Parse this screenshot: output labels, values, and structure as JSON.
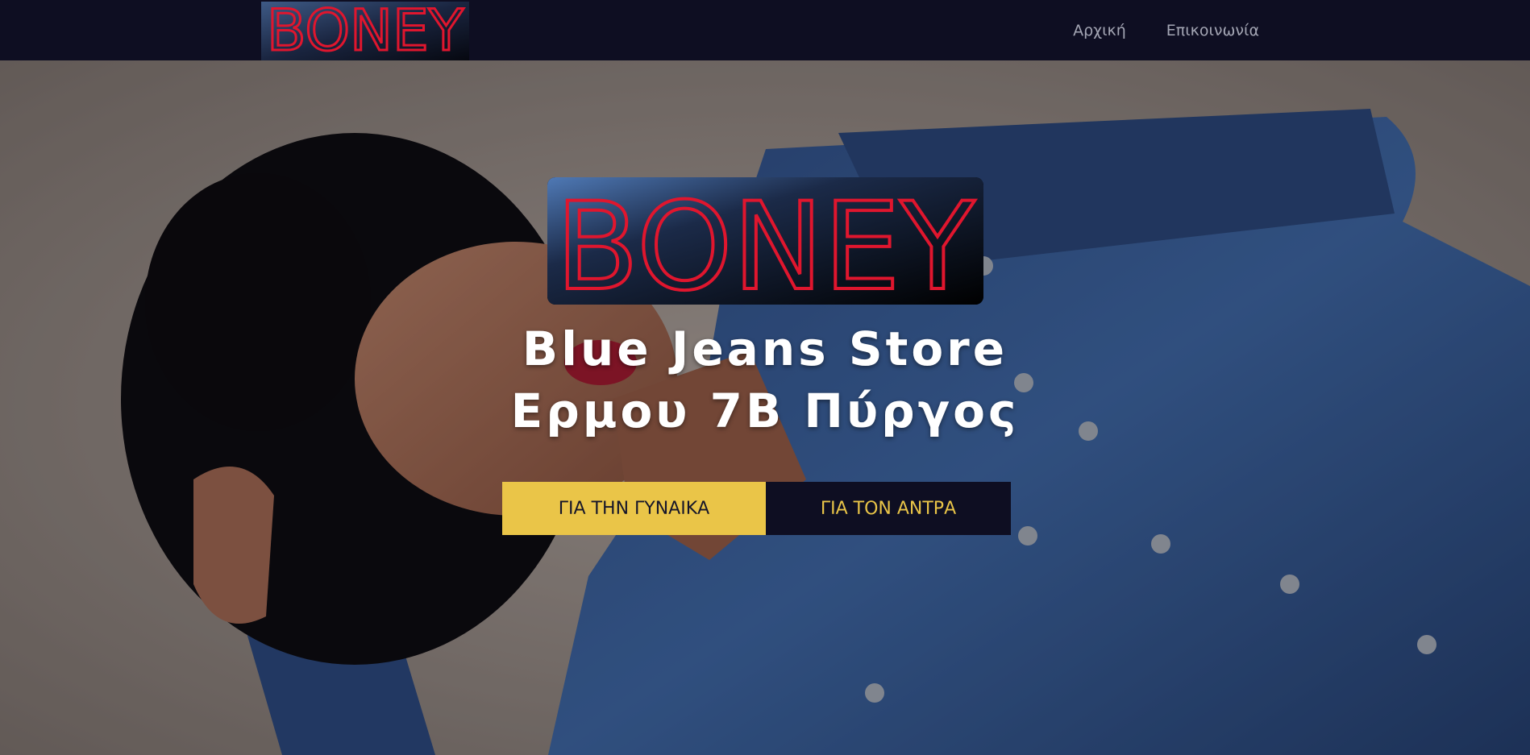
{
  "navbar": {
    "logo_text": "BONEY",
    "links": [
      {
        "label": "Αρχική"
      },
      {
        "label": "Επικοινωνία"
      }
    ]
  },
  "hero": {
    "logo_text": "BONEY",
    "title_line1": "Blue Jeans Store",
    "title_line2": "Ερμου 7Β Πύργος",
    "buttons": {
      "women_label": "ΓΙΑ ΤΗΝ ΓΥΝΑΙΚΑ",
      "men_label": "ΓΙΑ ΤΟΝ ΑΝΤΡΑ"
    }
  },
  "colors": {
    "nav_background": "#0e0e22",
    "accent_yellow": "#eac548",
    "logo_red": "#e0162e",
    "denim_blue": "#3a5f9a"
  },
  "icons": [
    "boney-logo"
  ]
}
